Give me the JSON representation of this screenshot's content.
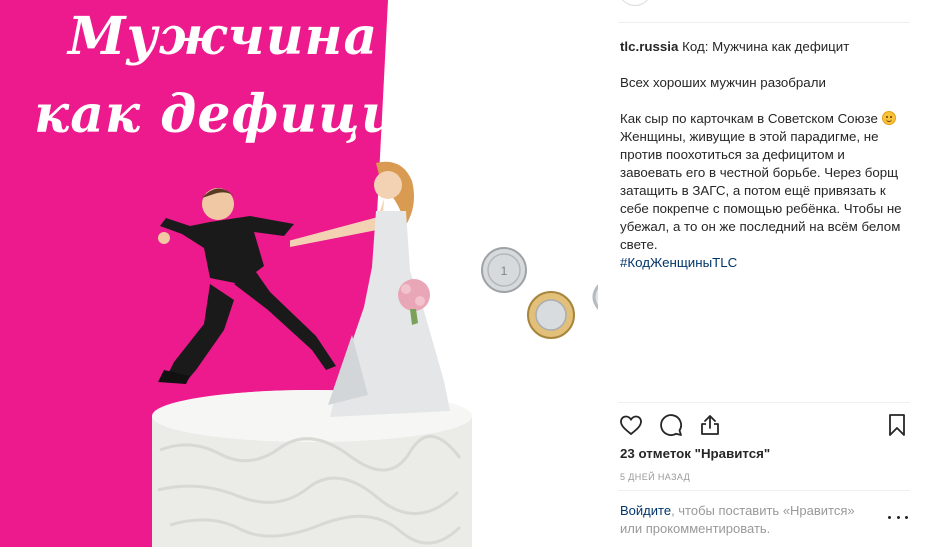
{
  "post_image": {
    "title_line_1": "Мужчина",
    "title_line_2": "как дефицит",
    "pink_color": "#ec1a8c"
  },
  "post": {
    "username": "tlc.russia",
    "caption_title": "Код: Мужчина как дефицит",
    "caption_line_1": "Всех хороших мужчин разобрали",
    "caption_body_start": "Как сыр по карточкам в Советском Союзе ",
    "caption_body_end": " Женщины, живущие в этой парадигме, не против поохотиться за дефицитом и завоевать его в честной борьбе. Через борщ затащить в ЗАГС, а потом ещё привязать к себе покрепче с помощью ребёнка. Чтобы не убежал, а то он же последний на всём белом свете.",
    "hashtag": "#КодЖенщиныTLC"
  },
  "actions": {
    "like_icon": "heart-icon",
    "comment_icon": "comment-icon",
    "share_icon": "share-icon",
    "save_icon": "bookmark-icon"
  },
  "likes_text": "23 отметок \"Нравится\"",
  "time_text": "5 ДНЕЙ НАЗАД",
  "login": {
    "link": "Войдите",
    "rest": ", чтобы поставить «Нравится» или прокомментировать."
  }
}
